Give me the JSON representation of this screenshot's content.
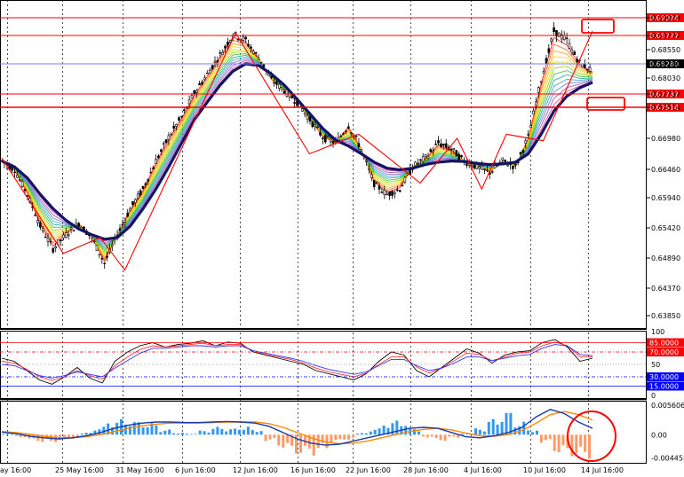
{
  "chart_data": [
    {
      "type": "candlestick",
      "panel": "price",
      "ylim": [
        0.6335,
        0.6915
      ],
      "y_ticks": [
        "0.69074",
        "0.68777",
        "0.68550",
        "0.68280",
        "0.68030",
        "0.67737",
        "0.67514",
        "0.66980",
        "0.66460",
        "0.65940",
        "0.65420",
        "0.64890",
        "0.64370",
        "0.63850"
      ],
      "x_ticks": [
        "ay 16:00",
        "25 May 16:00",
        "31 May 16:00",
        "6 Jun 16:00",
        "12 Jun 16:00",
        "16 Jun 16:00",
        "22 Jun 16:00",
        "28 Jun 16:00",
        "4 Jul 16:00",
        "10 Jul 16:00",
        "14 Jul 16:00"
      ],
      "horizontal_levels": [
        {
          "value": "0.69074",
          "color": "#ff0000",
          "tag_bg": "#ff0000",
          "tag_fg": "#ffffff"
        },
        {
          "value": "0.68777",
          "color": "#ff0000",
          "tag_bg": "#ff0000",
          "tag_fg": "#ffffff"
        },
        {
          "value": "0.68280",
          "color": "#7f7fff",
          "tag_bg": "#000000",
          "tag_fg": "#ffffff"
        },
        {
          "value": "0.67737",
          "color": "#ff0000",
          "tag_bg": "#ff0000",
          "tag_fg": "#ffffff"
        },
        {
          "value": "0.67514",
          "color": "#ff0000",
          "tag_bg": "#ff0000",
          "tag_fg": "#ffffff"
        }
      ],
      "close_path": [
        0.666,
        0.6645,
        0.66,
        0.6545,
        0.6505,
        0.653,
        0.655,
        0.6525,
        0.648,
        0.653,
        0.6575,
        0.661,
        0.666,
        0.67,
        0.6735,
        0.6775,
        0.681,
        0.6845,
        0.688,
        0.687,
        0.684,
        0.68,
        0.678,
        0.676,
        0.673,
        0.67,
        0.669,
        0.672,
        0.668,
        0.662,
        0.66,
        0.661,
        0.665,
        0.6665,
        0.669,
        0.668,
        0.666,
        0.665,
        0.664,
        0.666,
        0.665,
        0.67,
        0.68,
        0.6885,
        0.687,
        0.683,
        0.6815
      ],
      "slow_ma": [
        0.666,
        0.665,
        0.663,
        0.66,
        0.6575,
        0.6555,
        0.654,
        0.653,
        0.6522,
        0.6525,
        0.6545,
        0.6575,
        0.661,
        0.665,
        0.669,
        0.673,
        0.676,
        0.679,
        0.6815,
        0.6828,
        0.6825,
        0.681,
        0.679,
        0.6765,
        0.674,
        0.6715,
        0.6695,
        0.6685,
        0.6672,
        0.6658,
        0.6648,
        0.6645,
        0.6648,
        0.6654,
        0.6658,
        0.666,
        0.6659,
        0.6656,
        0.6654,
        0.6655,
        0.6658,
        0.6672,
        0.6705,
        0.6745,
        0.677,
        0.6785,
        0.6795
      ],
      "zigzag": [
        [
          0,
          0.6665
        ],
        [
          5,
          0.6497
        ],
        [
          8,
          0.6525
        ],
        [
          10,
          0.6468
        ],
        [
          19,
          0.6882
        ],
        [
          25,
          0.6672
        ],
        [
          29,
          0.6705
        ],
        [
          34,
          0.6621
        ],
        [
          37,
          0.6698
        ],
        [
          39,
          0.661
        ],
        [
          41,
          0.6705
        ],
        [
          44,
          0.6694
        ],
        [
          48,
          0.6885
        ]
      ]
    },
    {
      "type": "line",
      "panel": "stochastic",
      "ylim": [
        0,
        100
      ],
      "y_ticks": [
        "100",
        "85.0000",
        "70.0000",
        "50",
        "30.0000",
        "15.0000",
        "0"
      ],
      "levels": [
        {
          "value": 85,
          "label": "85.0000",
          "color": "#ff0000",
          "tag_bg": "#ff0000"
        },
        {
          "value": 70,
          "label": "70.0000",
          "color": "#ff0000",
          "tag_bg": "#ff0000"
        },
        {
          "value": 30,
          "label": "30.0000",
          "color": "#0000ff",
          "tag_bg": "#0000ff"
        },
        {
          "value": 15,
          "label": "15.0000",
          "color": "#0000ff",
          "tag_bg": "#0000ff"
        }
      ],
      "series": [
        {
          "color": "#000000",
          "values": [
            60,
            55,
            40,
            25,
            18,
            30,
            45,
            28,
            20,
            55,
            70,
            80,
            85,
            78,
            82,
            84,
            88,
            80,
            86,
            84,
            70,
            65,
            60,
            55,
            50,
            40,
            35,
            30,
            25,
            35,
            55,
            70,
            65,
            40,
            30,
            45,
            60,
            75,
            68,
            52,
            65,
            70,
            72,
            85,
            90,
            78,
            55,
            60
          ]
        },
        {
          "color": "#ff3333",
          "values": [
            55,
            52,
            42,
            30,
            24,
            30,
            40,
            32,
            26,
            48,
            62,
            74,
            80,
            78,
            80,
            82,
            84,
            80,
            82,
            82,
            72,
            66,
            62,
            58,
            52,
            44,
            38,
            34,
            30,
            36,
            50,
            62,
            62,
            46,
            36,
            44,
            56,
            68,
            66,
            56,
            62,
            68,
            70,
            80,
            86,
            80,
            62,
            62
          ]
        },
        {
          "color": "#3333ff",
          "values": [
            50,
            48,
            40,
            32,
            28,
            32,
            38,
            34,
            30,
            44,
            56,
            68,
            76,
            76,
            78,
            80,
            80,
            78,
            80,
            80,
            72,
            68,
            64,
            60,
            55,
            48,
            42,
            38,
            34,
            38,
            48,
            58,
            58,
            48,
            40,
            44,
            52,
            62,
            62,
            56,
            60,
            64,
            66,
            76,
            82,
            80,
            66,
            64
          ]
        }
      ],
      "label_50": "50"
    },
    {
      "type": "bar",
      "panel": "macd",
      "ylim": [
        -0.0045,
        0.0056
      ],
      "y_ticks": [
        "0.005606",
        "0.00",
        "-0.004455"
      ],
      "histogram": [
        0.0002,
        -0.0005,
        -0.0012,
        -0.0016,
        -0.0014,
        -0.0008,
        0.0004,
        0.0015,
        0.0028,
        0.003,
        0.0026,
        0.0022,
        0.001,
        0.0004,
        0.0002,
        0.0008,
        0.0015,
        0.0012,
        0.0016,
        0.001,
        -0.0012,
        -0.0025,
        -0.0038,
        -0.004,
        -0.0032,
        -0.0015,
        -0.001,
        0.0003,
        0.0012,
        0.0025,
        0.0028,
        0.0012,
        -0.0005,
        -0.0012,
        -0.0006,
        0.0002,
        0.0012,
        0.003,
        0.0045,
        0.0025,
        0.001,
        -0.0015,
        -0.0035,
        -0.0042,
        -0.0045
      ],
      "macd_line": [
        0.0005,
        0.0002,
        -0.0003,
        -0.0006,
        -0.0008,
        -0.0006,
        -0.0002,
        0.0004,
        0.0012,
        0.0018,
        0.0022,
        0.0024,
        0.0024,
        0.0023,
        0.0023,
        0.0024,
        0.0025,
        0.0024,
        0.0022,
        0.0016,
        0.0004,
        -0.0008,
        -0.0016,
        -0.002,
        -0.0018,
        -0.0012,
        -0.0006,
        0.0,
        0.0006,
        0.0012,
        0.0014,
        0.0012,
        0.0004,
        -0.0004,
        -0.0006,
        -0.0002,
        0.0004,
        0.0014,
        0.0034,
        0.0048,
        0.004,
        0.0024,
        0.0012
      ],
      "signal_line": [
        0.0006,
        0.0004,
        0.0001,
        -0.0003,
        -0.0006,
        -0.0006,
        -0.0004,
        0.0,
        0.0006,
        0.0012,
        0.0017,
        0.002,
        0.0022,
        0.0022,
        0.0022,
        0.0023,
        0.0024,
        0.0024,
        0.0024,
        0.0021,
        0.0014,
        0.0004,
        -0.0006,
        -0.0014,
        -0.0017,
        -0.0016,
        -0.0012,
        -0.0006,
        0.0,
        0.0006,
        0.001,
        0.0012,
        0.0009,
        0.0003,
        -0.0002,
        -0.0003,
        0.0,
        0.0008,
        0.0022,
        0.0038,
        0.0044,
        0.0038,
        0.0028
      ]
    }
  ]
}
